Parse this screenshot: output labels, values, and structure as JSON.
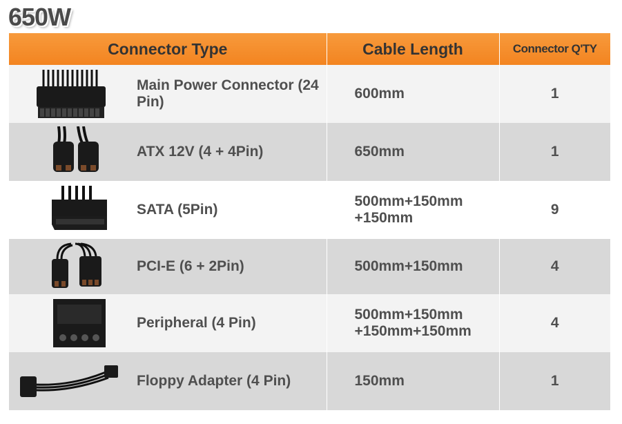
{
  "title": "650W",
  "headers": {
    "connector_type": "Connector Type",
    "cable_length": "Cable Length",
    "connector_qty": "Connector Q'TY"
  },
  "rows": [
    {
      "image": "atx-24pin-connector-image",
      "name": "Main Power Connector (24 Pin)",
      "length": "600mm",
      "qty": "1"
    },
    {
      "image": "atx-12v-4plus4-connector-image",
      "name": "ATX 12V (4 + 4Pin)",
      "length": "650mm",
      "qty": "1"
    },
    {
      "image": "sata-connector-image",
      "name": "SATA (5Pin)",
      "length": "500mm+150mm\n+150mm",
      "qty": "9"
    },
    {
      "image": "pcie-6plus2-connector-image",
      "name": "PCI-E (6 + 2Pin)",
      "length": "500mm+150mm",
      "qty": "4"
    },
    {
      "image": "molex-peripheral-connector-image",
      "name": "Peripheral (4 Pin)",
      "length": "500mm+150mm\n+150mm+150mm",
      "qty": "4"
    },
    {
      "image": "floppy-adapter-cable-image",
      "name": "Floppy Adapter (4 Pin)",
      "length": "150mm",
      "qty": "1"
    }
  ],
  "colors": {
    "header_orange": "#f38420",
    "text_gray": "#4f4f4f",
    "row_light": "#f3f3f3",
    "row_dark": "#d8d8d8"
  }
}
